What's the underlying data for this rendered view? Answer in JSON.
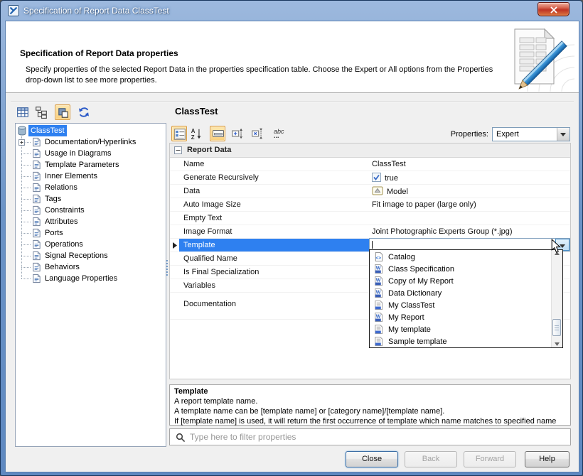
{
  "window": {
    "title": "Specification of Report Data ClassTest"
  },
  "header": {
    "title": "Specification of Report Data properties",
    "description_line1": "Specify properties of the selected Report Data in the properties specification table. Choose the Expert or All options from the Properties",
    "description_line2": "drop-down list to see more properties."
  },
  "left_toolbar": {
    "icons": [
      "table-view",
      "tree-view",
      "visible-panels",
      "refresh"
    ],
    "selected": "visible-panels"
  },
  "tree": {
    "root": "ClassTest",
    "items": [
      "Documentation/Hyperlinks",
      "Usage in Diagrams",
      "Template Parameters",
      "Inner Elements",
      "Relations",
      "Tags",
      "Constraints",
      "Attributes",
      "Ports",
      "Operations",
      "Signal Receptions",
      "Behaviors",
      "Language Properties"
    ]
  },
  "right": {
    "element_name": "ClassTest",
    "toolbar_icons": [
      "categorized-view",
      "sort-alphabetically",
      "show-description",
      "expand-nodes",
      "collapse-nodes",
      "abc-options"
    ],
    "toolbar_selected": [
      "categorized-view",
      "show-description"
    ],
    "properties_label": "Properties:",
    "properties_mode": "Expert",
    "table": {
      "group": "Report Data",
      "rows": [
        {
          "name": "Name",
          "value": "ClassTest"
        },
        {
          "name": "Generate Recursively",
          "value": "true",
          "control": "checkbox-checked"
        },
        {
          "name": "Data",
          "value": "Model",
          "control": "model-icon"
        },
        {
          "name": "Auto Image Size",
          "value": "Fit image to paper (large only)"
        },
        {
          "name": "Empty Text",
          "value": ""
        },
        {
          "name": "Image Format",
          "value": "Joint Photographic Experts Group (*.jpg)"
        },
        {
          "name": "Template",
          "value": "",
          "selected": true,
          "control": "combo-editor"
        },
        {
          "name": "Qualified Name",
          "value": ""
        },
        {
          "name": "Is Final Specialization",
          "value": ""
        },
        {
          "name": "Variables",
          "value": ""
        },
        {
          "name": "Documentation",
          "value": ""
        }
      ]
    },
    "template_dropdown": {
      "items": [
        {
          "label": "Catalog",
          "icon": "catalog-file-icon"
        },
        {
          "label": "Class Specification",
          "icon": "docx-file-icon"
        },
        {
          "label": "Copy of My Report",
          "icon": "docx-file-icon"
        },
        {
          "label": "Data Dictionary",
          "icon": "docx-file-icon"
        },
        {
          "label": "My ClassTest",
          "icon": "rtf-file-icon"
        },
        {
          "label": "My Report",
          "icon": "docx-file-icon"
        },
        {
          "label": "My template",
          "icon": "rtf-file-icon"
        },
        {
          "label": "Sample template",
          "icon": "rtf-file-icon"
        }
      ]
    }
  },
  "doc_panel": {
    "title": "Template",
    "lines": [
      "A report template name.",
      "A template name can be [template name] or [category name]/[template name].",
      "If [template name] is used, it will return the first occurrence of template which name matches to specified name"
    ]
  },
  "filter": {
    "placeholder": "Type here to filter properties"
  },
  "footer_buttons": [
    {
      "label": "Close",
      "enabled": true
    },
    {
      "label": "Back",
      "enabled": false
    },
    {
      "label": "Forward",
      "enabled": false
    },
    {
      "label": "Help",
      "enabled": true
    }
  ],
  "colors": {
    "titlebar_blue": "#6b93c6",
    "selection_blue": "#2e80f0",
    "toolbar_selected_bg": "#f9cf7d",
    "toolbar_selected_border": "#d89b43",
    "close_red": "#bf3425",
    "content_gray": "#f0f0f0"
  }
}
